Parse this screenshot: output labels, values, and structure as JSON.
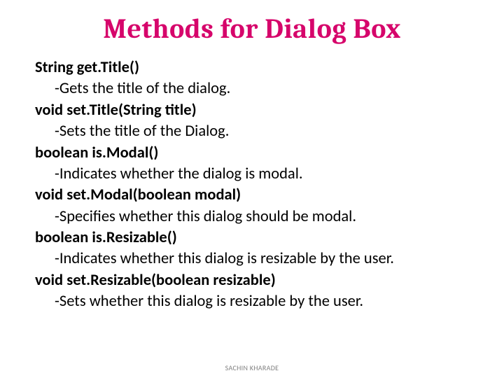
{
  "title": "Methods for Dialog Box",
  "methods": [
    {
      "signature": "String get.Title()",
      "description": "-Gets the title of the dialog."
    },
    {
      "signature": "void set.Title(String title)",
      "description": "-Sets the title of the Dialog."
    },
    {
      "signature": "boolean is.Modal()",
      "description": "-Indicates whether the dialog is modal."
    },
    {
      "signature": "void set.Modal(boolean modal)",
      "description": "-Specifies whether this dialog should be modal."
    },
    {
      "signature": "boolean is.Resizable()",
      "description": "-Indicates whether this dialog is resizable by the user."
    },
    {
      "signature": "void set.Resizable(boolean resizable)",
      "description": "-Sets whether this dialog is resizable by the user."
    }
  ],
  "footer": "SACHIN KHARADE"
}
